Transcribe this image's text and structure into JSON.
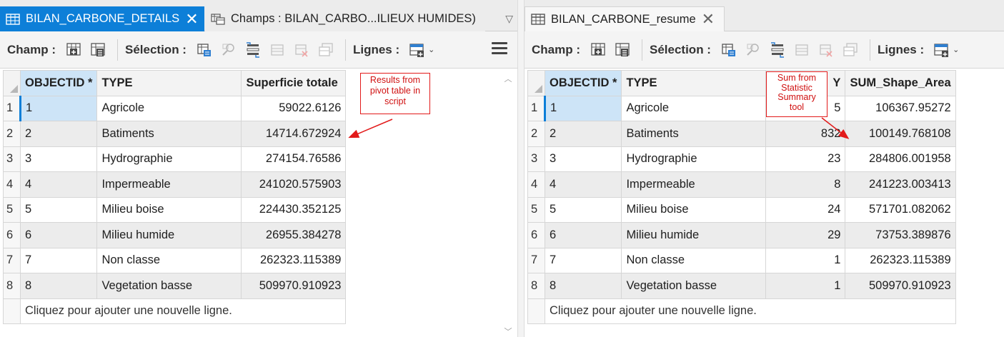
{
  "left": {
    "tabs": [
      {
        "label": "BILAN_CARBONE_DETAILS",
        "active": true
      },
      {
        "label": "Champs : BILAN_CARBO...ILIEUX HUMIDES)",
        "active": false
      }
    ],
    "toolbar": {
      "champ_label": "Champ :",
      "selection_label": "Sélection :",
      "lignes_label": "Lignes :"
    },
    "columns": [
      "OBJECTID *",
      "TYPE",
      "Superficie totale"
    ],
    "rows": [
      {
        "n": "1",
        "oid": "1",
        "type": "Agricole",
        "value": "59022.6126"
      },
      {
        "n": "2",
        "oid": "2",
        "type": "Batiments",
        "value": "14714.672924"
      },
      {
        "n": "3",
        "oid": "3",
        "type": "Hydrographie",
        "value": "274154.76586"
      },
      {
        "n": "4",
        "oid": "4",
        "type": "Impermeable",
        "value": "241020.575903"
      },
      {
        "n": "5",
        "oid": "5",
        "type": "Milieu boise",
        "value": "224430.352125"
      },
      {
        "n": "6",
        "oid": "6",
        "type": "Milieu humide",
        "value": "26955.384278"
      },
      {
        "n": "7",
        "oid": "7",
        "type": "Non classe",
        "value": "262323.115389"
      },
      {
        "n": "8",
        "oid": "8",
        "type": "Vegetation basse",
        "value": "509970.910923"
      }
    ],
    "add_row": "Cliquez pour ajouter une nouvelle ligne.",
    "callout": "Results from pivot table in script"
  },
  "right": {
    "tabs": [
      {
        "label": "BILAN_CARBONE_resume",
        "active": false
      }
    ],
    "toolbar": {
      "champ_label": "Champ :",
      "selection_label": "Sélection :",
      "lignes_label": "Lignes :"
    },
    "columns": [
      "OBJECTID *",
      "TYPE",
      "Y",
      "SUM_Shape_Area"
    ],
    "rows": [
      {
        "n": "1",
        "oid": "1",
        "type": "Agricole",
        "freq": "5",
        "value": "106367.95272"
      },
      {
        "n": "2",
        "oid": "2",
        "type": "Batiments",
        "freq": "832",
        "value": "100149.768108"
      },
      {
        "n": "3",
        "oid": "3",
        "type": "Hydrographie",
        "freq": "23",
        "value": "284806.001958"
      },
      {
        "n": "4",
        "oid": "4",
        "type": "Impermeable",
        "freq": "8",
        "value": "241223.003413"
      },
      {
        "n": "5",
        "oid": "5",
        "type": "Milieu boise",
        "freq": "24",
        "value": "571701.082062"
      },
      {
        "n": "6",
        "oid": "6",
        "type": "Milieu humide",
        "freq": "29",
        "value": "73753.389876"
      },
      {
        "n": "7",
        "oid": "7",
        "type": "Non classe",
        "freq": "1",
        "value": "262323.115389"
      },
      {
        "n": "8",
        "oid": "8",
        "type": "Vegetation basse",
        "freq": "1",
        "value": "509970.910923"
      }
    ],
    "add_row": "Cliquez pour ajouter une nouvelle ligne.",
    "callout": "Sum from Statistic Summary tool"
  },
  "colors": {
    "tab_active": "#0d7fd8",
    "selected_cell": "#cde4f7",
    "callout": "#e21a1a"
  },
  "icons": [
    "table-icon",
    "fields-icon",
    "close-icon",
    "chevron-down-icon",
    "add-field-icon",
    "calculate-field-icon",
    "select-by-attributes-icon",
    "zoom-to-selection-icon",
    "switch-selection-icon",
    "clear-selection-icon",
    "delete-selection-icon",
    "copy-selection-icon",
    "add-row-icon",
    "menu-icon"
  ]
}
